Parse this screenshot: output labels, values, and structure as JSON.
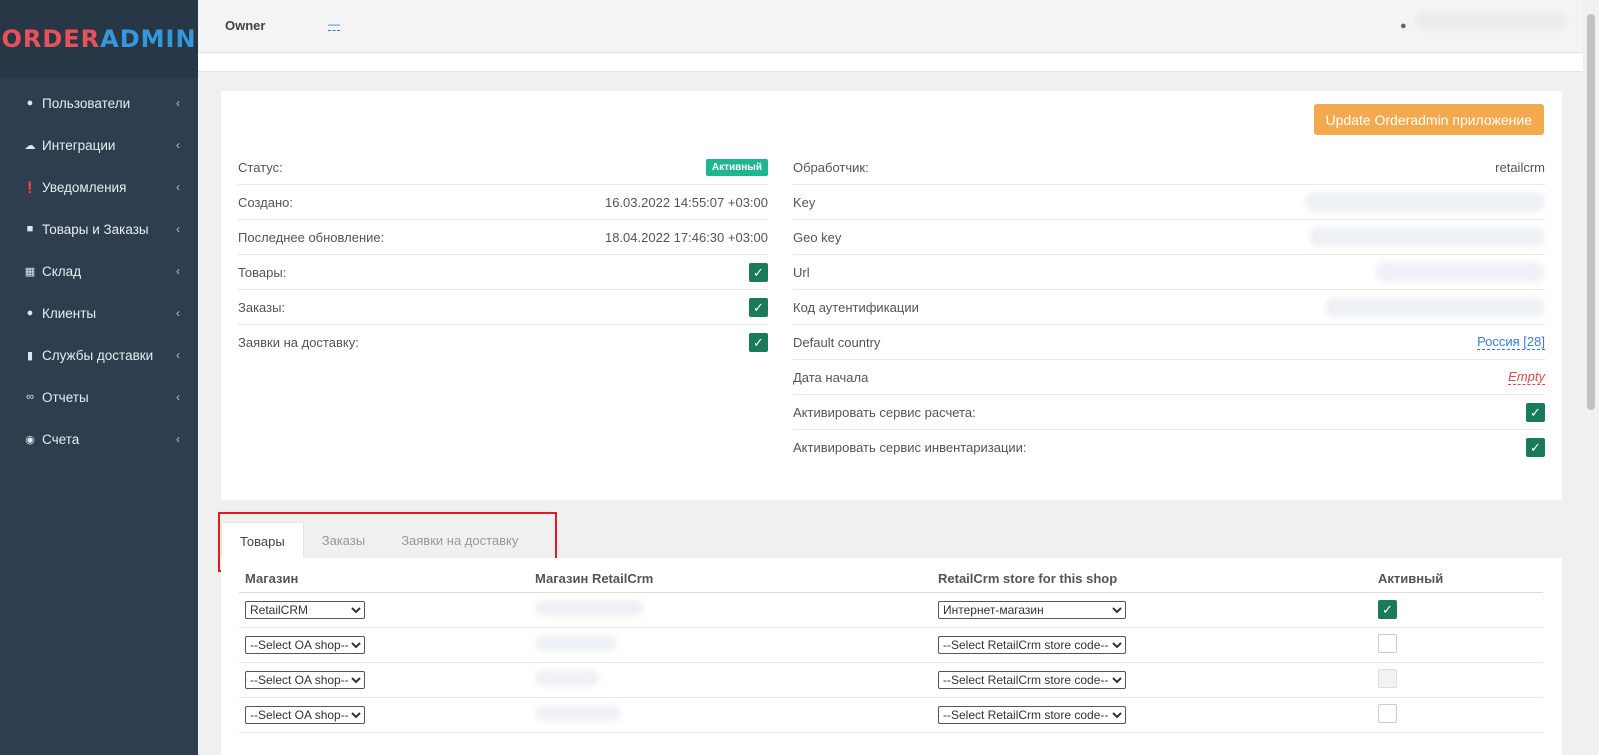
{
  "logo": {
    "part1": "ORDER",
    "part2": "ADMIN"
  },
  "sidebar": {
    "items": [
      {
        "label": "Пользователи",
        "icon": "user-icon"
      },
      {
        "label": "Интеграции",
        "icon": "cloud-icon"
      },
      {
        "label": "Уведомления",
        "icon": "info-icon"
      },
      {
        "label": "Товары и Заказы",
        "icon": "cart-icon"
      },
      {
        "label": "Склад",
        "icon": "cubes-icon"
      },
      {
        "label": "Клиенты",
        "icon": "users-icon"
      },
      {
        "label": "Службы доставки",
        "icon": "truck-icon"
      },
      {
        "label": "Отчеты",
        "icon": "paperclip-icon"
      },
      {
        "label": "Счета",
        "icon": "piggy-bank-icon"
      }
    ]
  },
  "topbar": {
    "owner_label": "Owner",
    "owner_value": "—"
  },
  "panel": {
    "update_button": "Update Orderadmin приложение",
    "left": {
      "status_label": "Статус:",
      "status_value": "Активный",
      "created_label": "Создано:",
      "created_value": "16.03.2022 14:55:07 +03:00",
      "updated_label": "Последнее обновление:",
      "updated_value": "18.04.2022 17:46:30 +03:00",
      "products_label": "Товары:",
      "orders_label": "Заказы:",
      "delivery_label": "Заявки на доставку:"
    },
    "right": {
      "handler_label": "Обработчик:",
      "handler_value": "retailcrm",
      "key_label": "Key",
      "geokey_label": "Geo key",
      "url_label": "Url",
      "auth_label": "Код аутентификации",
      "country_label": "Default country",
      "country_value": "Россия [28]",
      "start_label": "Дата начала",
      "start_value": "Empty",
      "calc_label": "Активировать сервис расчета:",
      "inventory_label": "Активировать сервис инвентаризации:"
    }
  },
  "tabs": [
    "Товары",
    "Заказы",
    "Заявки на доставку"
  ],
  "table": {
    "headers": [
      "Магазин",
      "Магазин RetailCrm",
      "RetailCrm store for this shop",
      "Активный"
    ],
    "rows": [
      {
        "shop": "RetailCRM",
        "store": "Интернет-магазин",
        "active": true
      },
      {
        "shop": "--Select OA shop--",
        "store": "--Select RetailCrm store code--",
        "active": false
      },
      {
        "shop": "--Select OA shop--",
        "store": "--Select RetailCrm store code--",
        "active": false
      },
      {
        "shop": "--Select OA shop--",
        "store": "--Select RetailCrm store code--",
        "active": false
      }
    ]
  },
  "colors": {
    "sidebar_bg": "#2e3e4e",
    "accent_orange": "#f5a94f",
    "badge_green": "#1fb58f",
    "check_green": "#1a7a5a",
    "logo_red": "#e8505b",
    "logo_blue": "#3498db"
  }
}
